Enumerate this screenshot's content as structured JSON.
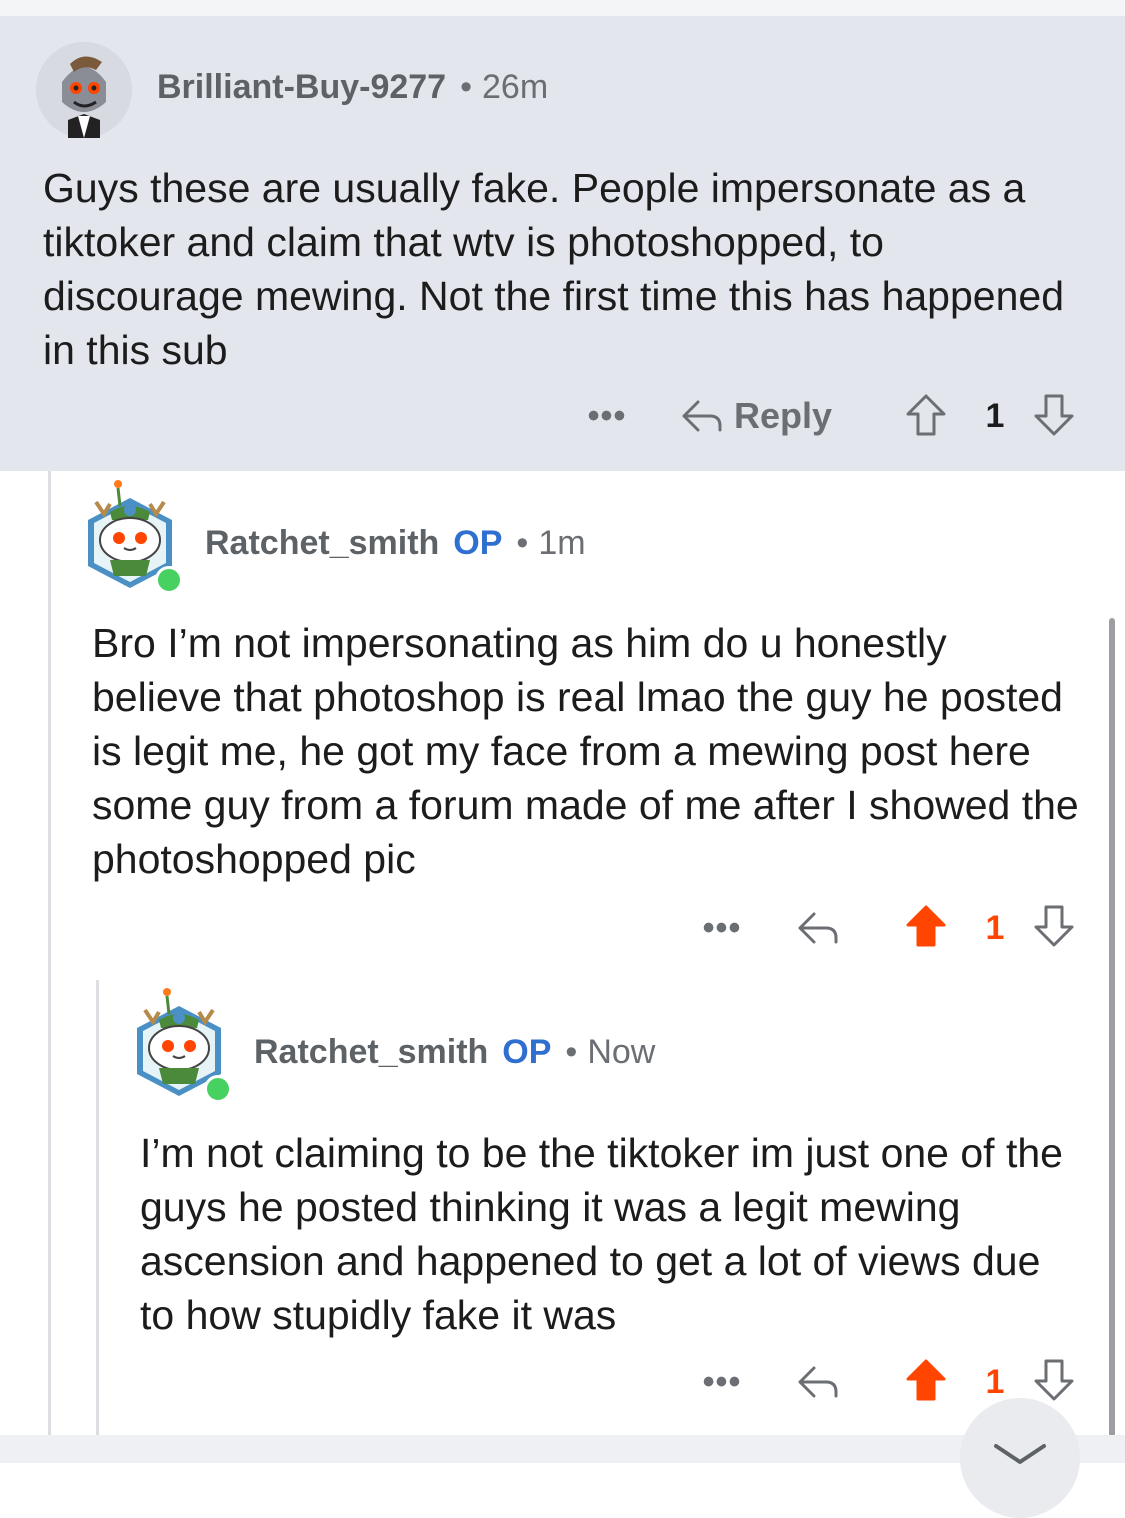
{
  "comments": [
    {
      "username": "Brilliant-Buy-9277",
      "separator": "•",
      "time": "26m",
      "body": "Guys these are usually fake. People impersonate as a tiktoker and claim that wtv is photoshopped, to discourage mewing. Not the first time this has happened in this sub",
      "more": "•••",
      "reply_label": "Reply",
      "score": "1",
      "upvoted": false
    },
    {
      "username": "Ratchet_smith",
      "op_badge": "OP",
      "separator": "•",
      "time": "1m",
      "body": "Bro I’m not impersonating as him do u honestly believe that photoshop is real lmao the guy he posted is legit me, he got my face from a mewing post here some guy from a forum made of me after I showed the photoshopped pic",
      "more": "•••",
      "score": "1",
      "upvoted": true
    },
    {
      "username": "Ratchet_smith",
      "op_badge": "OP",
      "separator": "•",
      "time": "Now",
      "body": "I’m not claiming to be the tiktoker im just one of the guys he posted thinking it was a legit mewing ascension and happened to get a lot of views due to how stupidly fake it was",
      "more": "•••",
      "score": "1",
      "upvoted": true
    }
  ],
  "colors": {
    "highlight_bg": "#e3e6ed",
    "upvote_active": "#ff4500",
    "op_badge": "#2f6fd0",
    "online": "#46d160",
    "muted_text": "#6b6f73"
  },
  "icons": [
    "reply-arrow-icon",
    "upvote-icon",
    "downvote-icon",
    "more-options-icon",
    "chevron-down-icon"
  ]
}
